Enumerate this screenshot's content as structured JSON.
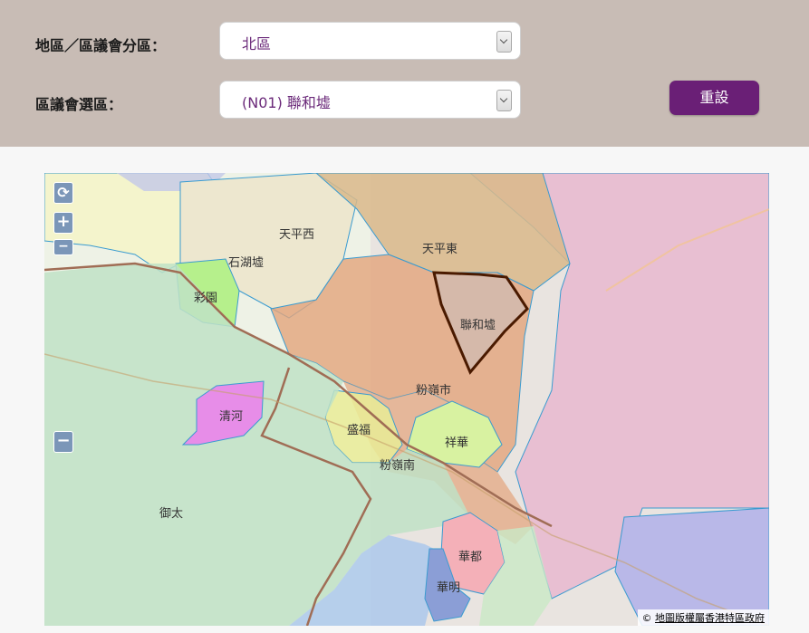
{
  "filters": {
    "region_label": "地區／區議會分區：",
    "region_value": "北區",
    "constituency_label": "區議會選區：",
    "constituency_value": "(N01) 聯和墟",
    "reset_label": "重設"
  },
  "map": {
    "controls": {
      "refresh": "⟳",
      "zoom_in": "+",
      "zoom_out": "−",
      "zoom_out2": "−"
    },
    "districts": [
      {
        "name": "天平西"
      },
      {
        "name": "天平東"
      },
      {
        "name": "石湖墟"
      },
      {
        "name": "彩園"
      },
      {
        "name": "聯和墟"
      },
      {
        "name": "粉嶺市"
      },
      {
        "name": "清河"
      },
      {
        "name": "盛福"
      },
      {
        "name": "祥華"
      },
      {
        "name": "粉嶺南"
      },
      {
        "name": "御太"
      },
      {
        "name": "華都"
      },
      {
        "name": "華明"
      }
    ],
    "copyright_symbol": "©",
    "copyright_text": "地圖版權屬香港特區政府",
    "colors": {
      "selected_outline": "#4a1a00",
      "tin_ping_east": "#d9b98a",
      "fanling_town": "#d9a07a",
      "wah_do": "#f4b0b8",
      "wah_ming": "#8b9ed6",
      "ching_ho": "#e78de8",
      "choi_yuen": "#b6f08c"
    }
  }
}
